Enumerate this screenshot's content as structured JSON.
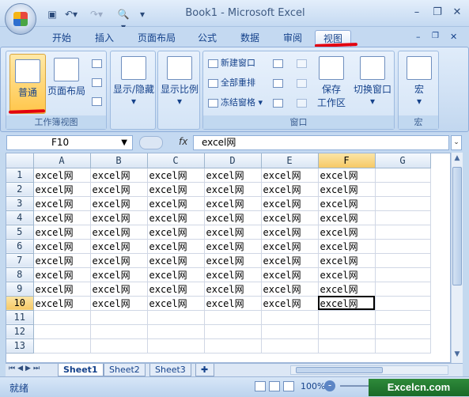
{
  "window": {
    "title": "Book1 - Microsoft Excel"
  },
  "tabs": [
    "开始",
    "插入",
    "页面布局",
    "公式",
    "数据",
    "审阅",
    "视图"
  ],
  "ribbon": {
    "workbook_views": {
      "label": "工作簿视图",
      "normal": "普通",
      "page_layout": "页面布局"
    },
    "show_hide": "显示/隐藏",
    "zoom": "显示比例",
    "window": {
      "label": "窗口",
      "new_window": "新建窗口",
      "arrange_all": "全部重排",
      "freeze_panes": "冻结窗格",
      "save_workspace_1": "保存",
      "save_workspace_2": "工作区",
      "switch_windows": "切换窗口"
    },
    "macros": {
      "label": "宏",
      "macros": "宏"
    }
  },
  "formula_bar": {
    "name_box": "F10",
    "fx": "fx",
    "value": "excel网"
  },
  "columns": [
    "A",
    "B",
    "C",
    "D",
    "E",
    "F",
    "G"
  ],
  "rows": [
    1,
    2,
    3,
    4,
    5,
    6,
    7,
    8,
    9,
    10,
    11,
    12,
    13
  ],
  "cell_text": "excel网",
  "filled_rows": 10,
  "filled_cols": 6,
  "active_cell": {
    "row": 10,
    "col": "F"
  },
  "sheet_tabs": [
    "Sheet1",
    "Sheet2",
    "Sheet3"
  ],
  "status": {
    "ready": "就绪",
    "zoom": "100%",
    "watermark": "Excelcn.com"
  }
}
